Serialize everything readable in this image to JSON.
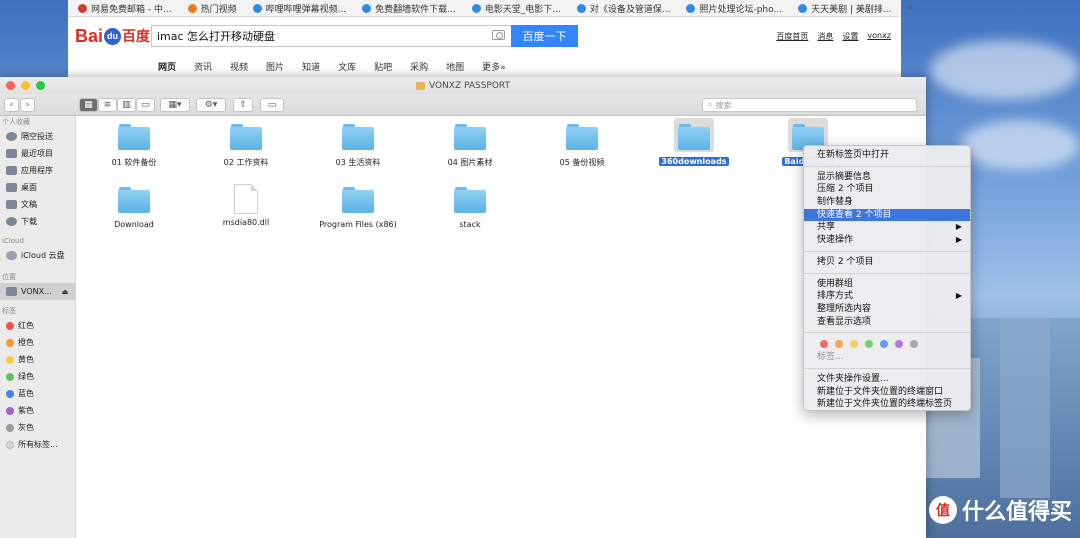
{
  "browser": {
    "tabs": [
      "网易免费邮箱 - 中...",
      "热门视频",
      "哔哩哔哩弹幕视频...",
      "免费翻墙软件下载...",
      "电影天堂_电影下...",
      "对《设备及管道保...",
      "照片处理论坛-pho...",
      "天天美剧 | 美剧排..."
    ],
    "tab_more": "»",
    "logo_left": "Bai",
    "logo_paw": "du",
    "logo_right": "百度",
    "search_value": "imac 怎么打开移动硬盘",
    "search_button": "百度一下",
    "top_links": [
      "百度首页",
      "消息",
      "设置",
      "vonxz"
    ],
    "nav": [
      "网页",
      "资讯",
      "视频",
      "图片",
      "知道",
      "文库",
      "贴吧",
      "采购",
      "地图",
      "更多»"
    ]
  },
  "finder": {
    "title": "VONXZ PASSPORT",
    "search_placeholder": "搜索",
    "sidebar": {
      "favorites_head": "个人收藏",
      "favorites": [
        "隔空投送",
        "最近项目",
        "应用程序",
        "桌面",
        "文稿",
        "下载"
      ],
      "icloud_head": "iCloud",
      "icloud": [
        "iCloud 云盘"
      ],
      "locations_head": "位置",
      "locations": [
        "VONX..."
      ],
      "tags_head": "标签",
      "tags": [
        {
          "label": "红色",
          "color": "#f2534c"
        },
        {
          "label": "橙色",
          "color": "#f39a34"
        },
        {
          "label": "黄色",
          "color": "#f4cc3c"
        },
        {
          "label": "绿色",
          "color": "#5bc65b"
        },
        {
          "label": "蓝色",
          "color": "#3f86f0"
        },
        {
          "label": "紫色",
          "color": "#a65fcf"
        },
        {
          "label": "灰色",
          "color": "#9a9a9a"
        },
        {
          "label": "所有标签...",
          "color": "#d8d8d8"
        }
      ]
    },
    "files": [
      "01 软件备份",
      "02 工作资料",
      "03 生活资料",
      "04 图片素材",
      "05 备份视频",
      "360downloads",
      "BaiduNetd",
      "Download",
      "msdia80.dll",
      "Program Files (x86)",
      "stack"
    ]
  },
  "context_menu": {
    "items": [
      "在新标签页中打开",
      "显示摘要信息",
      "压缩 2 个项目",
      "制作替身",
      "快速查看 2 个项目",
      "共享",
      "快速操作",
      "拷贝 2 个项目",
      "使用群组",
      "排序方式",
      "整理所选内容",
      "查看显示选项",
      "标签...",
      "文件夹操作设置...",
      "新建位于文件夹位置的终端窗口",
      "新建位于文件夹位置的终端标签页"
    ],
    "highlighted": "快速查看 2 个项目",
    "tag_colors": [
      "#ee6b63",
      "#f2a55a",
      "#f4cf5a",
      "#77cf6d",
      "#5f9bf0",
      "#b27ad8",
      "#a8a8a8"
    ]
  },
  "watermark": {
    "icon": "值",
    "text": "什么值得买"
  }
}
